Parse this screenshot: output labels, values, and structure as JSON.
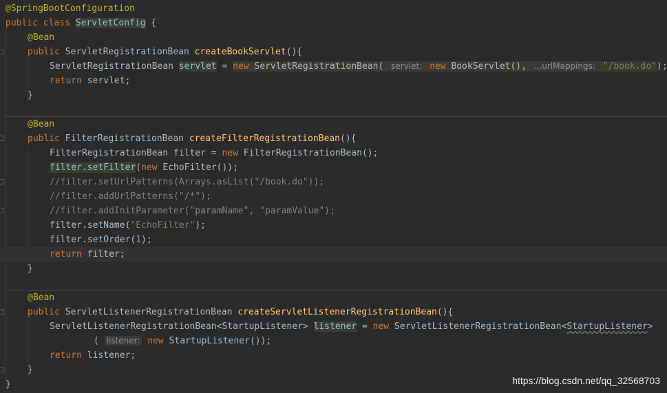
{
  "code": {
    "annotation_class": "@SpringBootConfiguration",
    "kw_public": "public",
    "kw_class": "class",
    "class_name": "ServletConfig",
    "brace_open": " {",
    "bean": "@Bean",
    "servlet_method": {
      "return_type": "ServletRegistrationBean",
      "name": "createBookServlet",
      "sig_end": "(){",
      "line1_type": "ServletRegistrationBean ",
      "var": "servlet",
      "eq": " = ",
      "kw_new": "new",
      "ctor": " ServletRegistrationBean(",
      "hint_servlet": "servlet:",
      "ctor2": " BookServlet(),",
      "hint_url": "...urlMappings:",
      "url_value": "\"/book.do\"",
      "end": ");",
      "return_kw": "return",
      "return_var": " servlet;",
      "close": "}"
    },
    "filter_method": {
      "return_type": "FilterRegistrationBean",
      "name": "createFilterRegistrationBean",
      "sig_end": "(){",
      "decl": "FilterRegistrationBean filter = ",
      "ctor": " FilterRegistrationBean();",
      "set_filter": "filter.setFilter",
      "set_filter_arg": "(",
      "echo_ctor": " EchoFilter());",
      "comment1": "//filter.setUrlPatterns(Arrays.asList(\"/book.do\"));",
      "comment2": "//filter.addUrlPatterns(\"/*\");",
      "comment3": "//filter.addInitParameter(\"paramName\", \"paramValue\");",
      "set_name": "filter.setName(",
      "name_value": "\"EchoFilter\"",
      "set_name_end": ");",
      "set_order": "filter.setOrder(",
      "order_value": "1",
      "set_order_end": ");",
      "return_kw": "return",
      "return_var": " filter;",
      "close": "}"
    },
    "listener_method": {
      "return_type": "ServletListenerRegistrationBean",
      "name": "createServletListenerRegistrationBean",
      "sig_end": "(){",
      "decl_type": "ServletListenerRegistrationBean<StartupListener> ",
      "var": "listener",
      "eq": " = ",
      "ctor": " ServletListenerRegistrationBean<",
      "ctor_generic": "StartupListener",
      "ctor_gt": ">",
      "paren": "(",
      "hint_listener": "listener:",
      "ctor2": " StartupListener());",
      "return_kw": "return",
      "return_var": " listener;",
      "close": "}"
    },
    "class_close": "}"
  },
  "watermark": "https://blog.csdn.net/qq_32568703",
  "colors": {
    "background": "#2b2b2b",
    "keyword": "#cc7832",
    "method": "#ffc66d",
    "string": "#6a8759",
    "annotation": "#bbb529",
    "comment": "#808080",
    "number": "#6897bb",
    "text": "#a9b7c6"
  }
}
